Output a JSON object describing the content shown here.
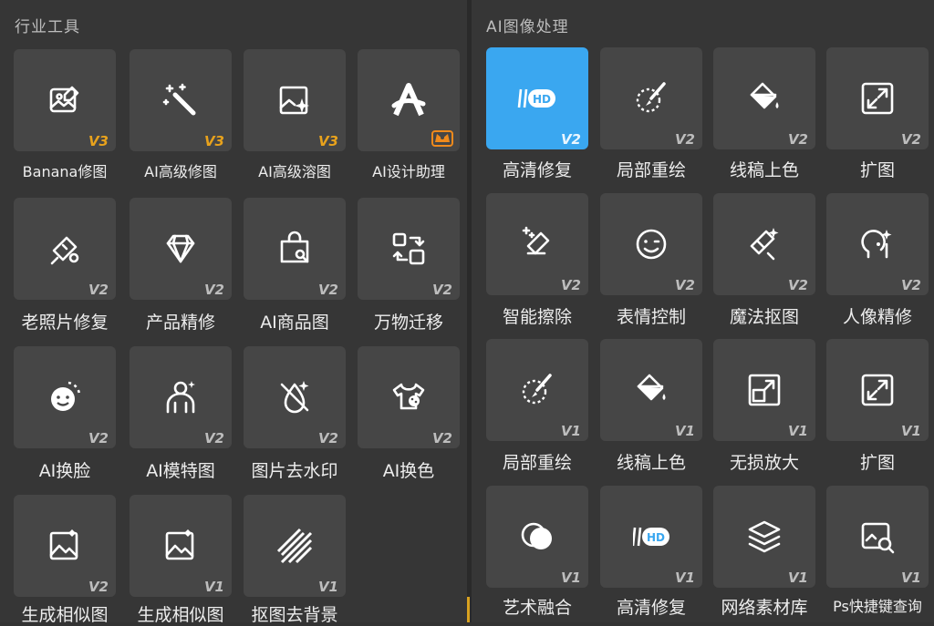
{
  "left": {
    "title": "行业工具",
    "tools": [
      {
        "label": "Banana修图",
        "badge": "V3",
        "icon": "image-edit-icon"
      },
      {
        "label": "AI高级修图",
        "badge": "V3",
        "icon": "magic-wand-icon"
      },
      {
        "label": "AI高级溶图",
        "badge": "V3",
        "icon": "image-sparkle-icon"
      },
      {
        "label": "AI设计助理",
        "badge": "",
        "icon": "ai-letter-a-icon",
        "premium": "crown-icon"
      },
      {
        "label": "老照片修复",
        "badge": "V2",
        "icon": "photo-restore-icon"
      },
      {
        "label": "产品精修",
        "badge": "V2",
        "icon": "diamond-icon"
      },
      {
        "label": "AI商品图",
        "badge": "V2",
        "icon": "shopping-bag-icon"
      },
      {
        "label": "万物迁移",
        "badge": "V2",
        "icon": "transfer-icon"
      },
      {
        "label": "AI换脸",
        "badge": "V2",
        "icon": "face-swap-icon"
      },
      {
        "label": "AI模特图",
        "badge": "V2",
        "icon": "model-person-icon"
      },
      {
        "label": "图片去水印",
        "badge": "V2",
        "icon": "remove-watermark-icon"
      },
      {
        "label": "AI换色",
        "badge": "V2",
        "icon": "recolor-shirt-icon"
      },
      {
        "label": "生成相似图",
        "badge": "V2",
        "icon": "similar-image-icon"
      },
      {
        "label": "生成相似图",
        "badge": "V1",
        "icon": "similar-image-icon"
      },
      {
        "label": "抠图去背景",
        "badge": "V1",
        "icon": "stripes-icon"
      }
    ]
  },
  "right": {
    "title": "AI图像处理",
    "tools": [
      {
        "label": "高清修复",
        "badge": "V2",
        "icon": "hd-icon",
        "active": true
      },
      {
        "label": "局部重绘",
        "badge": "V2",
        "icon": "brush-circle-icon"
      },
      {
        "label": "线稿上色",
        "badge": "V2",
        "icon": "paint-bucket-icon"
      },
      {
        "label": "扩图",
        "badge": "V2",
        "icon": "expand-icon"
      },
      {
        "label": "智能擦除",
        "badge": "V2",
        "icon": "eraser-icon"
      },
      {
        "label": "表情控制",
        "badge": "V2",
        "icon": "smile-icon"
      },
      {
        "label": "魔法抠图",
        "badge": "V2",
        "icon": "magic-cutout-icon"
      },
      {
        "label": "人像精修",
        "badge": "V2",
        "icon": "portrait-retouch-icon"
      },
      {
        "label": "局部重绘",
        "badge": "V1",
        "icon": "brush-circle-icon"
      },
      {
        "label": "线稿上色",
        "badge": "V1",
        "icon": "paint-bucket-icon"
      },
      {
        "label": "无损放大",
        "badge": "V1",
        "icon": "upscale-icon"
      },
      {
        "label": "扩图",
        "badge": "V1",
        "icon": "expand-icon"
      },
      {
        "label": "艺术融合",
        "badge": "V1",
        "icon": "blend-circles-icon"
      },
      {
        "label": "高清修复",
        "badge": "V1",
        "icon": "hd-icon"
      },
      {
        "label": "网络素材库",
        "badge": "V1",
        "icon": "layers-icon"
      },
      {
        "label": "Ps快捷键查询",
        "badge": "V1",
        "icon": "search-image-icon"
      }
    ]
  }
}
